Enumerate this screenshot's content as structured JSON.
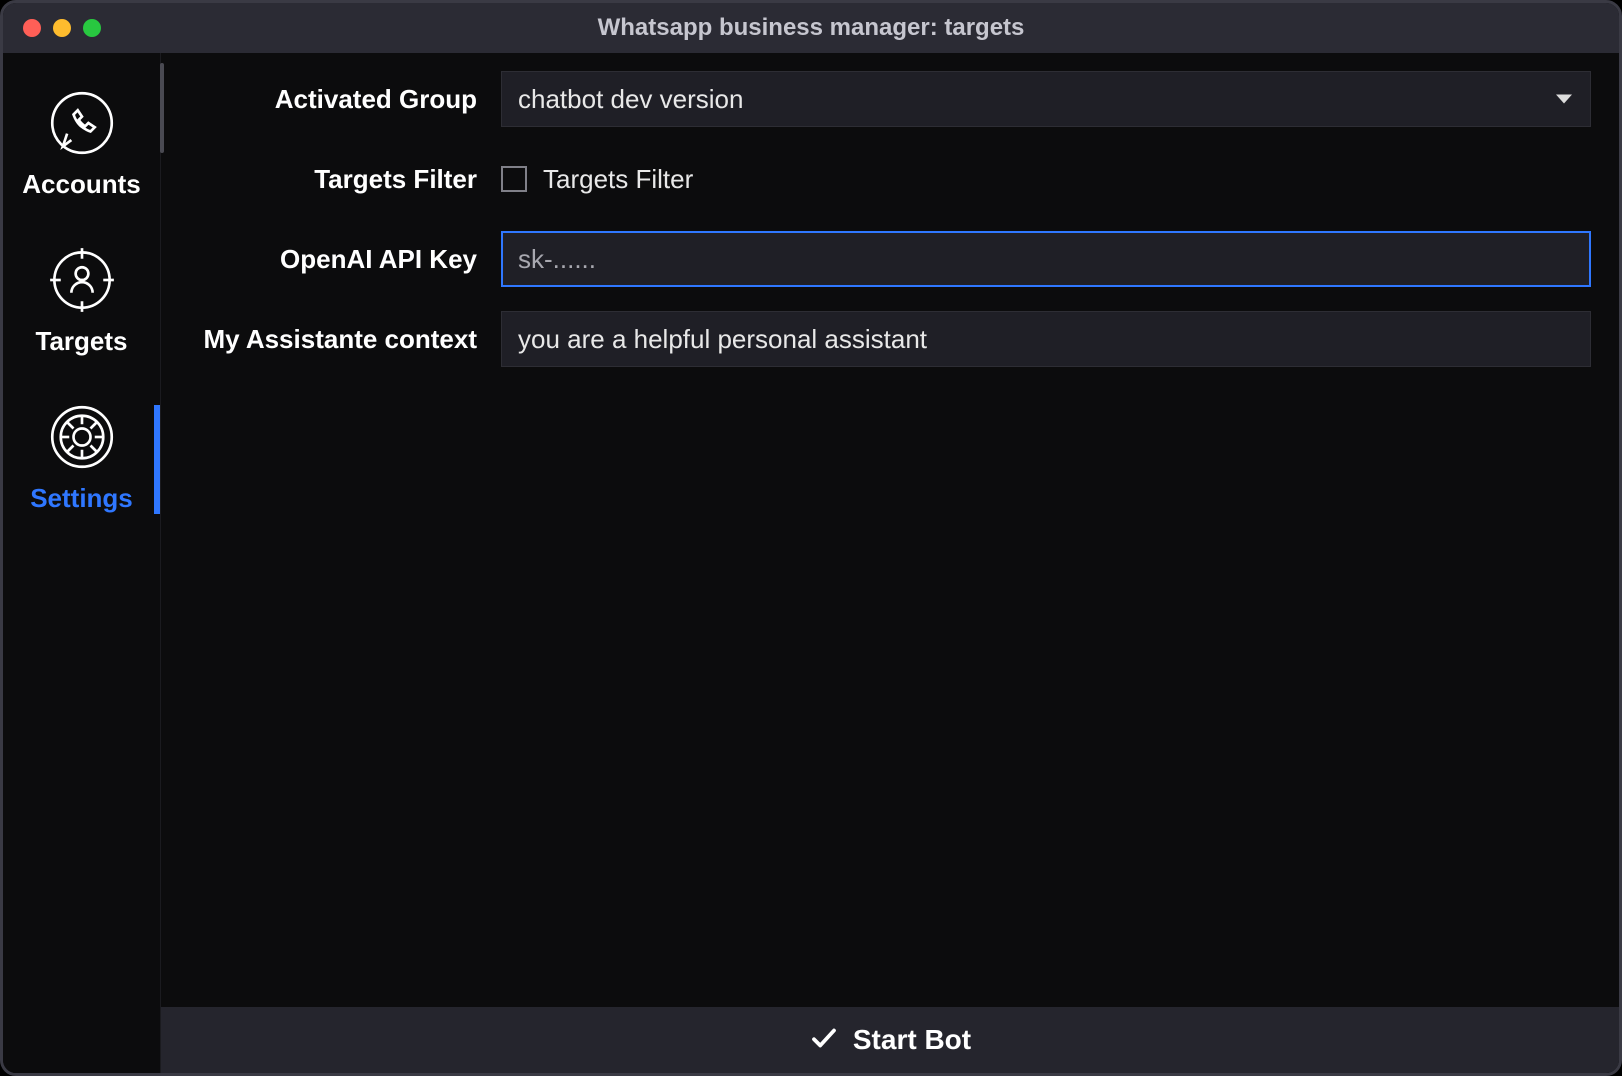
{
  "window": {
    "title": "Whatsapp business manager: targets"
  },
  "sidebar": {
    "items": [
      {
        "label": "Accounts",
        "icon": "phone-chat-icon",
        "active": false
      },
      {
        "label": "Targets",
        "icon": "target-person-icon",
        "active": false
      },
      {
        "label": "Settings",
        "icon": "gear-icon",
        "active": true
      }
    ]
  },
  "form": {
    "activated_group": {
      "label": "Activated Group",
      "value": "chatbot dev version"
    },
    "targets_filter": {
      "label": "Targets Filter",
      "checkbox_label": "Targets Filter",
      "checked": false
    },
    "openai_key": {
      "label": "OpenAI API Key",
      "placeholder": "sk-......",
      "value": "",
      "focused": true
    },
    "assistant_context": {
      "label": "My Assistante context",
      "value": "you are a helpful personal assistant"
    }
  },
  "footer": {
    "start_label": "Start Bot"
  }
}
